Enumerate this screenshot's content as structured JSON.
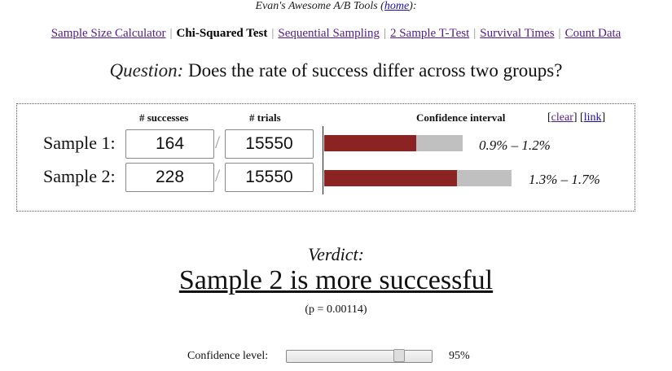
{
  "header": {
    "title_prefix": "Evan's Awesome A/B Tools (",
    "home_link": "home",
    "title_suffix": "):"
  },
  "nav": [
    {
      "label": "Sample Size Calculator",
      "active": false
    },
    {
      "label": "Chi-Squared Test",
      "active": true
    },
    {
      "label": "Sequential Sampling",
      "active": false
    },
    {
      "label": "2 Sample T-Test",
      "active": false
    },
    {
      "label": "Survival Times",
      "active": false
    },
    {
      "label": "Count Data",
      "active": false
    }
  ],
  "question": {
    "label": "Question:",
    "text": "Does the rate of success differ across two groups?"
  },
  "table": {
    "col_successes": "# successes",
    "col_trials": "# trials",
    "col_ci": "Confidence interval",
    "link_open": "[",
    "clear_link": "clear",
    "link_mid": "] [",
    "link_link": "link",
    "link_close": "]",
    "separator": "/",
    "samples": [
      {
        "label": "Sample 1:",
        "successes": "164",
        "trials": "15550",
        "ci": "0.9% – 1.2%",
        "ci_low": 0.9,
        "ci_high": 1.2
      },
      {
        "label": "Sample 2:",
        "successes": "228",
        "trials": "15550",
        "ci": "1.3% – 1.7%",
        "ci_low": 1.3,
        "ci_high": 1.7
      }
    ],
    "colors": {
      "bar_fill": "#8b2323",
      "bar_track": "#c0c0c0"
    }
  },
  "verdict": {
    "label": "Verdict:",
    "text": "Sample 2 is more successful",
    "p_value": "(p = 0.00114)"
  },
  "confidence": {
    "label": "Confidence level:",
    "value": "95%",
    "level": 0.8
  }
}
